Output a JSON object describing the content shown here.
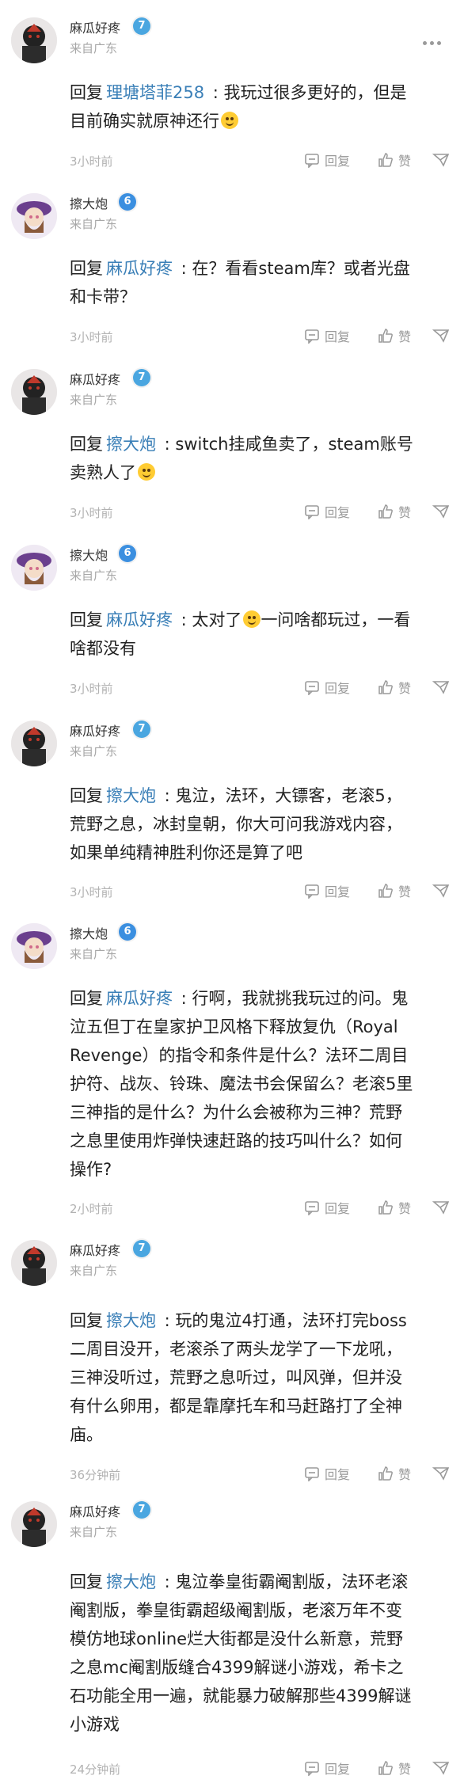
{
  "ui": {
    "reply_label": "回复",
    "reply_word": "回复",
    "like_label": "赞",
    "colors": {
      "mention": "#3a7fb7",
      "level_7": "#4aa6e0",
      "level_6": "#3b8fe0",
      "muted": "#a7a7a7"
    },
    "icons": {
      "more": "more-dots-icon",
      "reply": "comment-icon",
      "like": "thumb-up-icon",
      "share": "share-icon",
      "emoji": "grinning-tongue-emoji",
      "emoji_sweat": "grinning-sweat-emoji"
    }
  },
  "comments": [
    {
      "user": "麻瓜好疼",
      "level": "7",
      "location": "来自广东",
      "mention": "理塘塔菲258",
      "lines": [
        " : 我玩过很多更好的，但是",
        "目前确实就原神还行"
      ],
      "time": "3小时前"
    },
    {
      "user": "擦大炮",
      "level": "6",
      "location": "来自广东",
      "mention": "麻瓜好疼",
      "lines": [
        " : 在？看看steam库？或者光盘",
        "和卡带？"
      ],
      "time": "3小时前"
    },
    {
      "user": "麻瓜好疼",
      "level": "7",
      "location": "来自广东",
      "mention": "擦大炮",
      "lines": [
        " : switch挂咸鱼卖了，steam账号",
        "卖熟人了"
      ],
      "time": "3小时前"
    },
    {
      "user": "擦大炮",
      "level": "6",
      "location": "来自广东",
      "mention": "麻瓜好疼",
      "lines": [
        " : 太对了",
        "一问啥都玩过，一看",
        "啥都没有"
      ],
      "time": "3小时前"
    },
    {
      "user": "麻瓜好疼",
      "level": "7",
      "location": "来自广东",
      "mention": "擦大炮",
      "lines": [
        " : 鬼泣，法环，大镖客，老滚5，",
        "荒野之息，冰封皇朝，你大可问我游戏内容，",
        "如果单纯精神胜利你还是算了吧"
      ],
      "time": "3小时前"
    },
    {
      "user": "擦大炮",
      "level": "6",
      "location": "来自广东",
      "mention": "麻瓜好疼",
      "lines": [
        " : 行啊，我就挑我玩过的问。鬼",
        "泣五但丁在皇家护卫风格下释放复仇（Royal",
        "Revenge）的指令和条件是什么？法环二周目",
        "护符、战灰、铃珠、魔法书会保留么？老滚5里",
        "三神指的是什么？为什么会被称为三神？荒野",
        "之息里使用炸弹快速赶路的技巧叫什么？如何",
        "操作?"
      ],
      "time": "2小时前"
    },
    {
      "user": "麻瓜好疼",
      "level": "7",
      "location": "来自广东",
      "mention": "擦大炮",
      "lines": [
        " : 玩的鬼泣4打通，法环打完boss",
        "二周目没开，老滚杀了两头龙学了一下龙吼，",
        "三神没听过，荒野之息听过，叫风弹，但并没",
        "有什么卵用，都是靠摩托车和马赶路打了全神",
        "庙。"
      ],
      "time": "36分钟前"
    },
    {
      "user": "麻瓜好疼",
      "level": "7",
      "location": "来自广东",
      "mention": "擦大炮",
      "lines": [
        " : 鬼泣拳皇街霸阉割版，法环老滚",
        "阉割版，拳皇街霸超级阉割版，老滚万年不变",
        "模仿地球online烂大街都是没什么新意，荒野",
        "之息mc阉割版缝合4399解谜小游戏，希卡之",
        "石功能全用一遍，就能暴力破解那些4399解谜",
        "小游戏"
      ],
      "time": "24分钟前"
    }
  ]
}
